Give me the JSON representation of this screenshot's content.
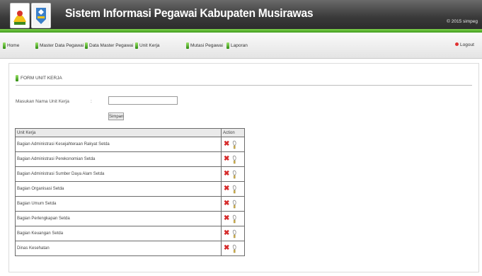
{
  "header": {
    "title": "Sistem Informasi Pegawai Kabupaten Musirawas",
    "copyright": "© 2015 simpeg"
  },
  "nav": {
    "items": [
      {
        "label": "Home",
        "icon": "leaf-icon"
      },
      {
        "label": "Master Data Pegawai",
        "icon": "leaf-icon"
      },
      {
        "label": "Data Master Pegawai",
        "icon": "leaf-icon"
      },
      {
        "label": "Unit Kerja",
        "icon": "leaf-icon"
      },
      {
        "label": "Mutasi Pegawai",
        "icon": "leaf-icon"
      },
      {
        "label": "Laporan",
        "icon": "leaf-icon"
      }
    ],
    "logout": {
      "label": "Logout",
      "icon": "logout-icon"
    }
  },
  "form": {
    "title": "FORM UNIT KERJA",
    "field_label": "Masukan Nama Unit Kerja",
    "colon": ":",
    "input_value": "",
    "submit_label": "Simpan"
  },
  "table": {
    "headers": [
      "Unit Kerja",
      "Action"
    ],
    "rows": [
      "Bagian Administrasi Kesejahteraan Rakyat Setda",
      "Bagian Administrasi Perekonomian Setda",
      "Bagian Administrasi Sumber Daya Alam Setda",
      "Bagian Organisasi Setda",
      "Bagian Umum Setda",
      "Bagian Perlengkapan Setda",
      "Bagian Keuangan Setda",
      "Dinas Kesehatan"
    ],
    "action_icons": [
      "delete-icon",
      "edit-icon"
    ]
  },
  "colors": {
    "header_bg": "#3a3a3a",
    "accent_green": "#4caf1f",
    "delete_red": "#d62b2b"
  }
}
